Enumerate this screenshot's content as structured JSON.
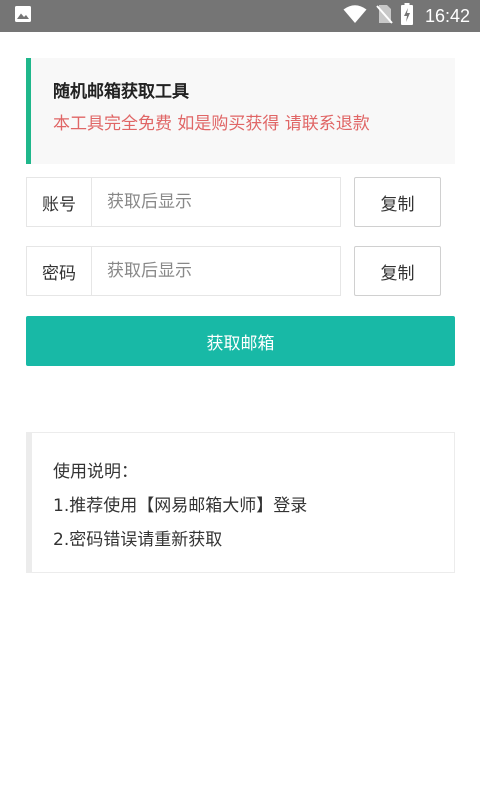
{
  "statusbar": {
    "time": "16:42",
    "icons": [
      "image-icon",
      "wifi-icon",
      "no-sim-icon",
      "battery-charging-icon"
    ]
  },
  "notice": {
    "title": "随机邮箱获取工具",
    "subtitle": "本工具完全免费 如是购买获得 请联系退款"
  },
  "account": {
    "label": "账号",
    "placeholder": "获取后显示",
    "value": "",
    "copy_label": "复制"
  },
  "password": {
    "label": "密码",
    "placeholder": "获取后显示",
    "value": "",
    "copy_label": "复制"
  },
  "get_button": {
    "label": "获取邮箱"
  },
  "instructions": {
    "heading": "使用说明：",
    "items": [
      "1.推荐使用【网易邮箱大师】登录",
      "2.密码错误请重新获取"
    ]
  },
  "colors": {
    "statusbar": "#757575",
    "accent_green": "#1fb78b",
    "button_teal": "#18b9a6",
    "warning_red": "#e06666"
  }
}
